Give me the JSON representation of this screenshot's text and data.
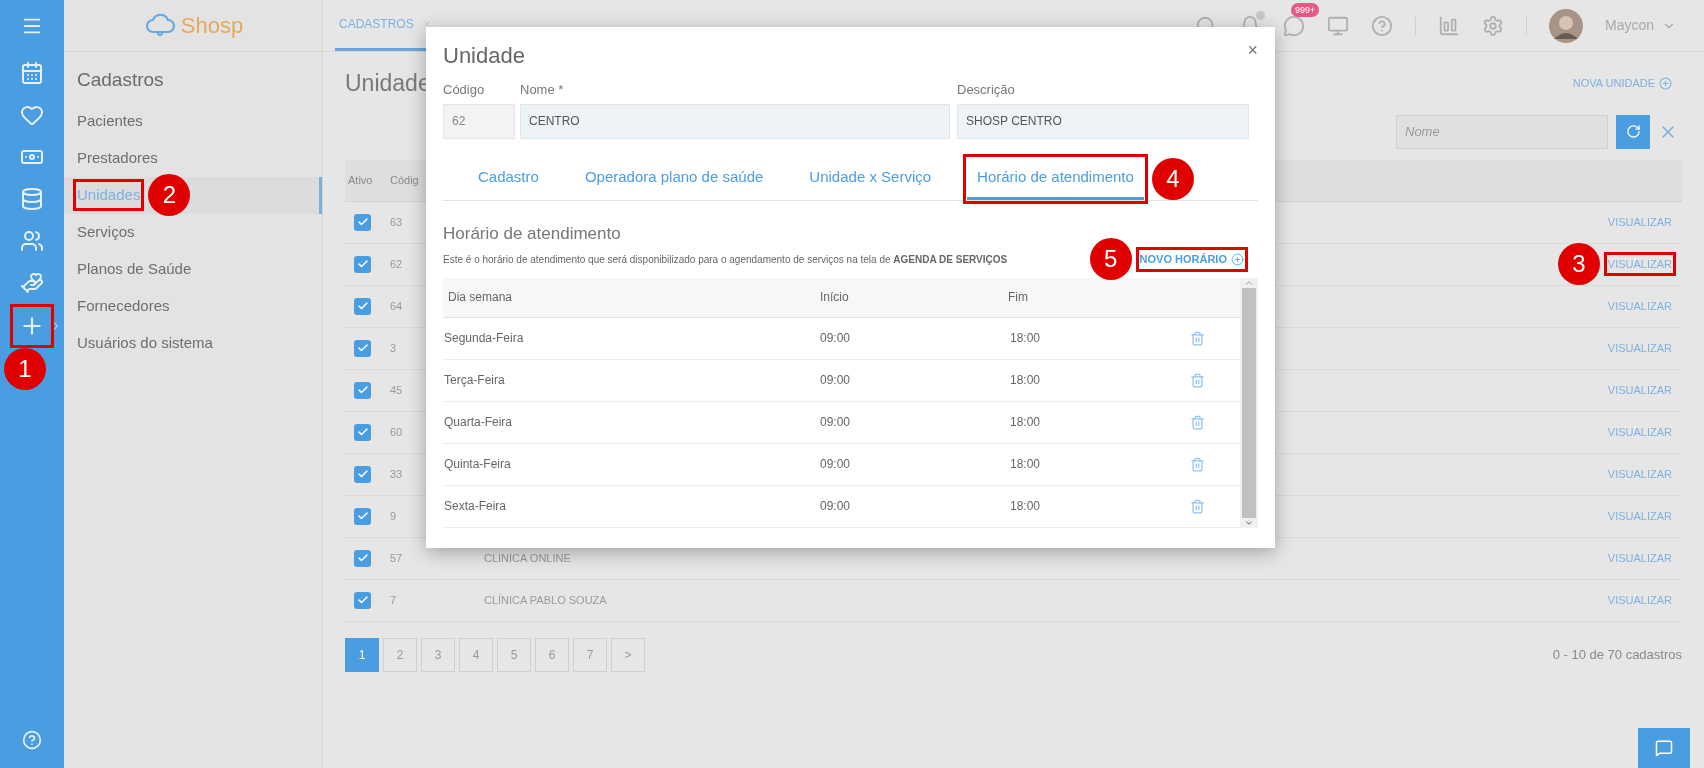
{
  "rail": {
    "callout": "1"
  },
  "logo": "Shosp",
  "top_tabs": [
    {
      "label": "CADASTROS",
      "selected": true
    }
  ],
  "notifications": {
    "badge": "999+"
  },
  "user": {
    "name": "Maycon"
  },
  "sidebar": {
    "title": "Cadastros",
    "items": [
      {
        "label": "Pacientes",
        "selected": false
      },
      {
        "label": "Prestadores",
        "selected": false
      },
      {
        "label": "Unidades",
        "selected": true,
        "callout": "2"
      },
      {
        "label": "Serviços",
        "selected": false
      },
      {
        "label": "Planos de Saúde",
        "selected": false
      },
      {
        "label": "Fornecedores",
        "selected": false
      },
      {
        "label": "Usuários do sistema",
        "selected": false
      }
    ]
  },
  "page": {
    "title": "Unidade",
    "new_button": "NOVA UNIDADE",
    "search": {
      "placeholder": "Nome"
    },
    "table": {
      "columns": [
        "Ativo",
        "Códig"
      ],
      "rows": [
        {
          "active": true,
          "code": "63",
          "action": "VISUALIZAR"
        },
        {
          "active": true,
          "code": "62",
          "action": "VISUALIZAR",
          "callout": "3"
        },
        {
          "active": true,
          "code": "64",
          "action": "VISUALIZAR"
        },
        {
          "active": true,
          "code": "3",
          "action": "VISUALIZAR"
        },
        {
          "active": true,
          "code": "45",
          "action": "VISUALIZAR"
        },
        {
          "active": true,
          "code": "60",
          "action": "VISUALIZAR"
        },
        {
          "active": true,
          "code": "33",
          "action": "VISUALIZAR"
        },
        {
          "active": true,
          "code": "9",
          "action": "VISUALIZAR"
        },
        {
          "active": true,
          "code": "57",
          "name": "CLINICA ONLINE",
          "action": "VISUALIZAR"
        },
        {
          "active": true,
          "code": "7",
          "name": "CLÍNICA PABLO SOUZA",
          "action": "VISUALIZAR"
        }
      ]
    },
    "pagination": {
      "pages": [
        {
          "label": "1",
          "selected": true
        },
        {
          "label": "2",
          "selected": false
        },
        {
          "label": "3",
          "selected": false
        },
        {
          "label": "4",
          "selected": false
        },
        {
          "label": "5",
          "selected": false
        },
        {
          "label": "6",
          "selected": false
        },
        {
          "label": "7",
          "selected": false
        },
        {
          "label": ">",
          "selected": false
        }
      ],
      "summary": "0 - 10 de 70 cadastros"
    }
  },
  "modal": {
    "title": "Unidade",
    "close": "×",
    "fields": [
      {
        "label": "Código",
        "value": "62",
        "disabled": true
      },
      {
        "label": "Nome *",
        "value": "CENTRO",
        "disabled": false
      },
      {
        "label": "Descrição",
        "value": "SHOSP CENTRO",
        "disabled": false
      }
    ],
    "tabs": [
      {
        "label": "Cadastro",
        "selected": false
      },
      {
        "label": "Operadora plano de saúde",
        "selected": false
      },
      {
        "label": "Unidade x Serviço",
        "selected": false
      },
      {
        "label": "Horário de atendimento",
        "selected": true,
        "callout": "4"
      }
    ],
    "section": {
      "title": "Horário de atendimento",
      "description": "Este é o horário de atendimento que será disponibilizado para o agendamento de serviços na tela de **AGENDA DE SERVIÇOS**",
      "new_button": {
        "label": "NOVO HORÁRIO",
        "callout": "5"
      },
      "table": {
        "columns": [
          "Dia semana",
          "Início",
          "Fim"
        ],
        "rows": [
          {
            "day": "Segunda-Feira",
            "start": "09:00",
            "end": "18:00"
          },
          {
            "day": "Terça-Feira",
            "start": "09:00",
            "end": "18:00"
          },
          {
            "day": "Quarta-Feira",
            "start": "09:00",
            "end": "18:00"
          },
          {
            "day": "Quinta-Feira",
            "start": "09:00",
            "end": "18:00"
          },
          {
            "day": "Sexta-Feira",
            "start": "09:00",
            "end": "18:00"
          }
        ]
      }
    }
  }
}
